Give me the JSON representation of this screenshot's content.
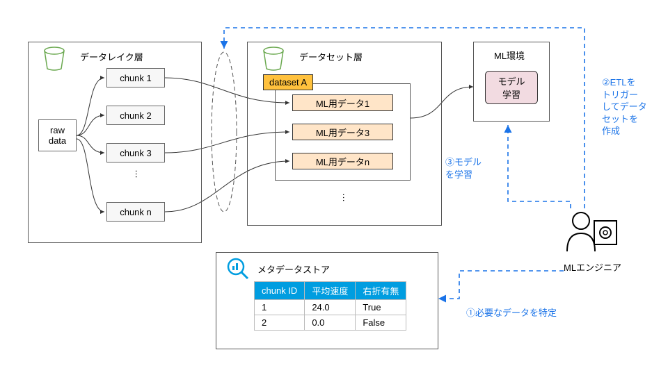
{
  "datalake": {
    "title": "データレイク層",
    "raw": "raw\ndata",
    "chunks": [
      "chunk 1",
      "chunk 2",
      "chunk 3",
      "chunk n"
    ]
  },
  "dataset": {
    "title": "データセット層",
    "tag": "dataset A",
    "items": [
      "ML用データ1",
      "ML用データ3",
      "ML用データn"
    ]
  },
  "mlenv": {
    "title": "ML環境",
    "model": "モデル\n学習"
  },
  "metastore": {
    "title": "メタデータストア",
    "headers": [
      "chunk ID",
      "平均速度",
      "右折有無"
    ],
    "rows": [
      [
        "1",
        "24.0",
        "True"
      ],
      [
        "2",
        "0.0",
        "False"
      ]
    ]
  },
  "engineer": "MLエンジニア",
  "steps": {
    "s1": "①必要なデータを特定",
    "s2": "②ETLを\nトリガー\nしてデータ\nセットを\n作成",
    "s3": "③モデル\nを学習"
  },
  "dots": "…"
}
